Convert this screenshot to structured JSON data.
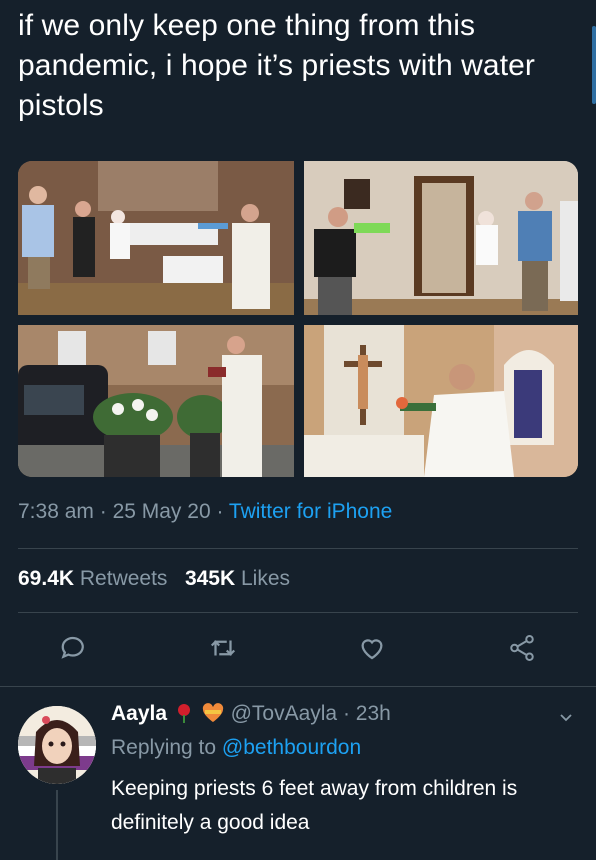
{
  "tweet": {
    "text": "if we only keep one thing from this pandemic, i hope it’s priests with water pistols",
    "time": "7:38 am",
    "date": "25 May 20",
    "source": "Twitter for iPhone",
    "retweets_count": "69.4K",
    "retweets_label": "Retweets",
    "likes_count": "345K",
    "likes_label": "Likes"
  },
  "actions": {
    "reply_icon": "comment-icon",
    "retweet_icon": "retweet-icon",
    "like_icon": "heart-icon",
    "share_icon": "share-icon"
  },
  "reply": {
    "name": "Aayla",
    "emoji": [
      "rose-icon",
      "heart-ribbon-icon"
    ],
    "handle": "@TovAayla",
    "time": "23h",
    "replying_prefix": "Replying to",
    "replying_to": "@bethbourdon",
    "text": "Keeping priests 6 feet away from children is definitely a good idea"
  },
  "colors": {
    "background": "#15202b",
    "muted": "#8899a6",
    "accent": "#1da1f2",
    "divider": "#38444d"
  }
}
